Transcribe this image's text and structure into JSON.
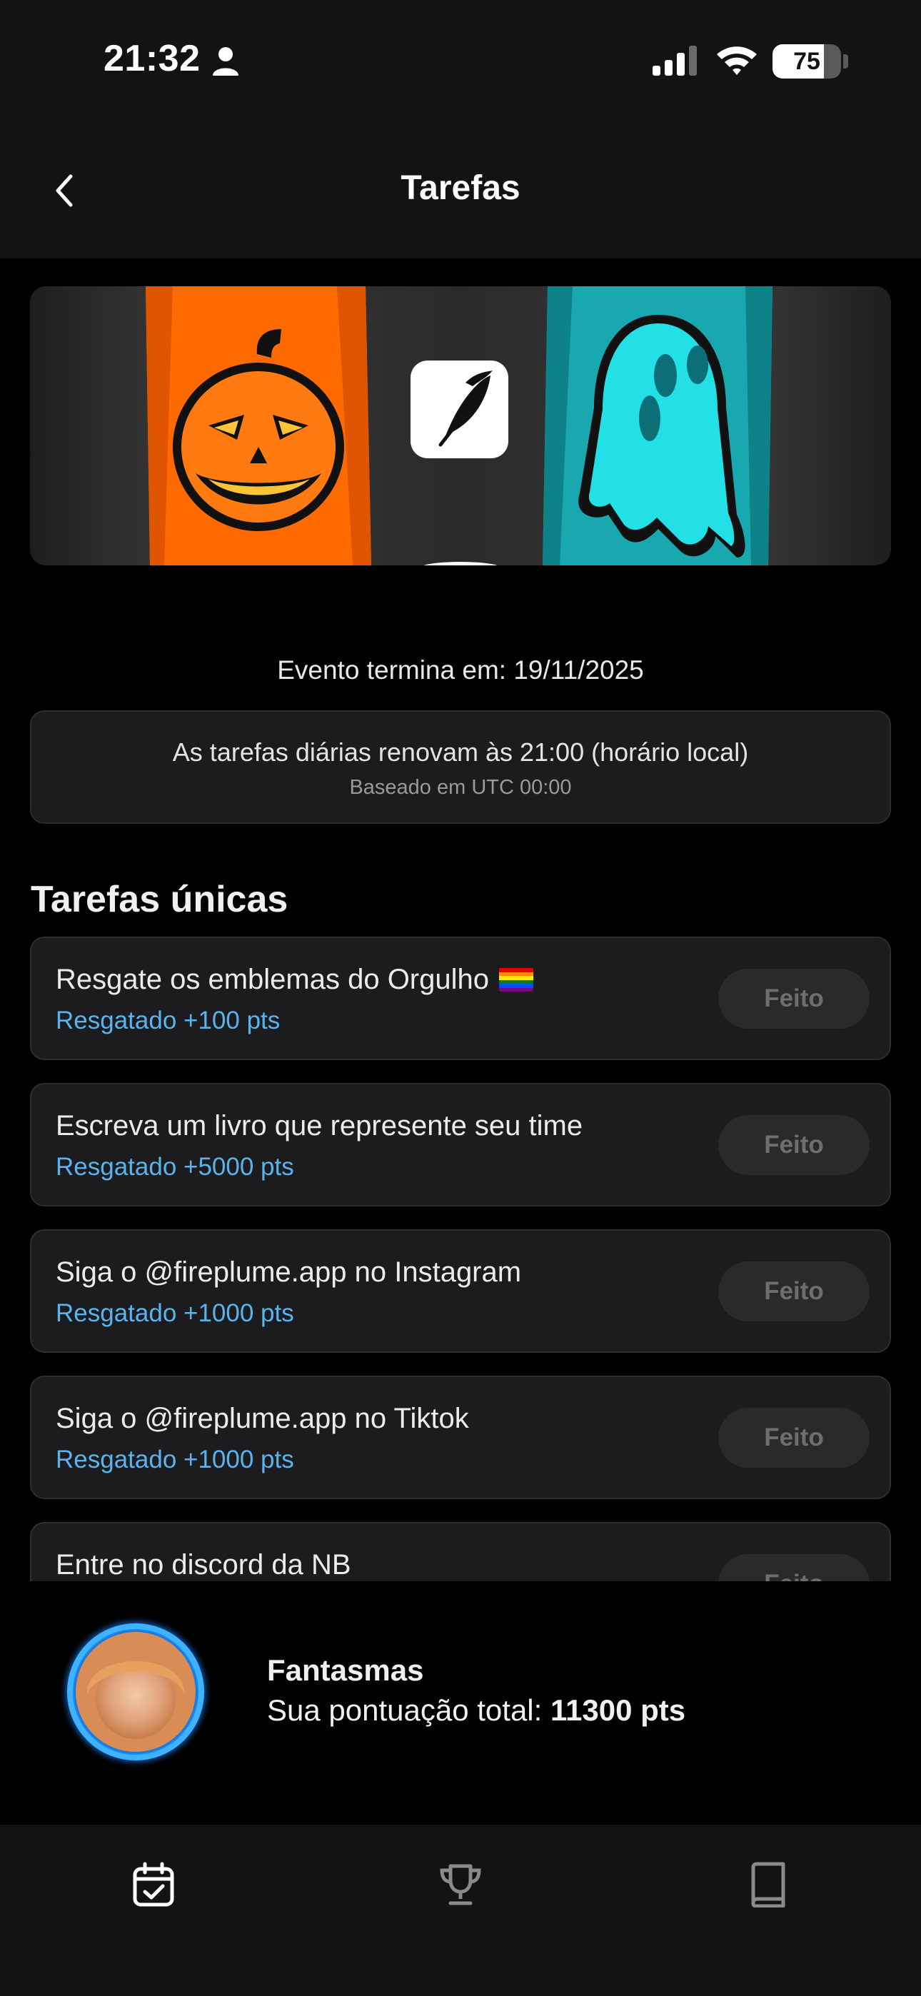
{
  "status_bar": {
    "time": "21:32",
    "battery": "75",
    "battery_level": 0.75
  },
  "header": {
    "title": "Tarefas"
  },
  "banner": {
    "description_icons": [
      "pumpkin-icon",
      "feather-logo-icon",
      "ghost-icon"
    ]
  },
  "event": {
    "end_text": "Evento termina em: 19/11/2025",
    "renew_text": "As tarefas diárias renovam às 21:00 (horário local)",
    "renew_subtext": "Baseado em UTC 00:00"
  },
  "section": {
    "title": "Tarefas únicas"
  },
  "tasks": [
    {
      "title": "Resgate os emblemas do Orgulho",
      "reward": "Resgatado +100 pts",
      "button": "Feito"
    },
    {
      "title": "Escreva um livro que represente seu time",
      "reward": "Resgatado +5000 pts",
      "button": "Feito"
    },
    {
      "title": "Siga o @fireplume.app no Instagram",
      "reward": "Resgatado +1000 pts",
      "button": "Feito"
    },
    {
      "title": "Siga o @fireplume.app no Tiktok",
      "reward": "Resgatado +1000 pts",
      "button": "Feito"
    },
    {
      "title": "Entre no discord da NB",
      "reward": "",
      "button": "Feito"
    }
  ],
  "team": {
    "name": "Fantasmas",
    "score_label": "Sua pontuação total: ",
    "score_value": "11300 pts"
  },
  "tabs": [
    "tasks-calendar-icon",
    "trophy-icon",
    "book-icon"
  ],
  "colors": {
    "accent": "#58b4ee",
    "card": "#1c1c1e",
    "background": "#000000"
  }
}
